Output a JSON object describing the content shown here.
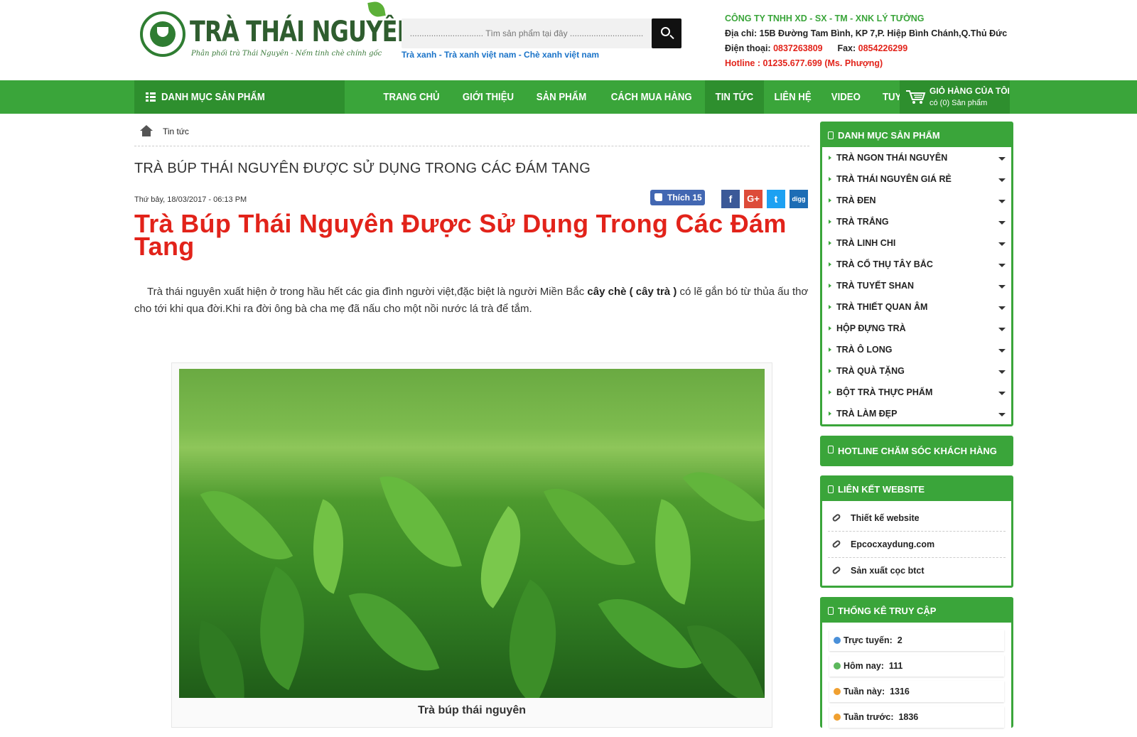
{
  "header": {
    "logo_title": "TRÀ THÁI NGUYÊN",
    "logo_slogan": "Phân phối trà Thái Nguyên - Nếm tinh chè chính gốc",
    "search_placeholder": "............................... Tìm sản phẩm tại đây ...............................",
    "search_tags": "Trà xanh - Trà xanh việt nam - Chè xanh việt nam",
    "company_name": "CÔNG TY TNHH XD - SX - TM - XNK LÝ TƯỞNG",
    "address": "Địa chỉ: 15B Đường Tam Bình, KP 7,P. Hiệp Bình Chánh,Q.Thủ Đức",
    "phone_label": "Điện thoại:",
    "phone": "0837263809",
    "fax_label": "Fax:",
    "fax": "0854226299",
    "hotline": "Hotline : 01235.677.699 (Ms. Phượng)"
  },
  "nav": {
    "category_button": "DANH MỤC SẢN PHẨM",
    "items": [
      "TRANG CHỦ",
      "GIỚI THIỆU",
      "SẢN PHẨM",
      "CÁCH MUA HÀNG",
      "TIN TỨC",
      "LIÊN HỆ",
      "VIDEO",
      "TUYỂN DỤNG"
    ],
    "active": "TIN TỨC",
    "cart_title": "GIỎ HÀNG CỦA TÔI",
    "cart_count": "có (0) Sản phẩm"
  },
  "breadcrumb": "Tin tức",
  "article": {
    "page_title": "TRÀ BÚP THÁI NGUYÊN ĐƯỢC SỬ DỤNG TRONG CÁC ĐÁM TANG",
    "date": "Thứ bảy, 18/03/2017 - 06:13 PM",
    "like_label": "Thích 15",
    "share": [
      "f",
      "G+",
      "t",
      "digg"
    ],
    "headline": "Trà Búp Thái Nguyên Được Sử Dụng Trong Các Đám Tang",
    "intro_a": "Trà thái nguyên xuất hiện ở trong hầu hết các gia đình người việt,đặc biệt là người Miền Bắc ",
    "intro_bold": "cây chè ( cây trà )",
    "intro_b": " có lẽ gắn bó từ thủa ấu thơ cho tới khi qua đời.Khi ra đời ông bà cha mẹ đã nấu cho một nồi nước lá trà để tắm.",
    "image_caption": "Trà búp thái nguyên"
  },
  "sidebar": {
    "categories_title": "DANH MỤC SẢN PHẨM",
    "categories": [
      "TRÀ NGON THÁI NGUYÊN",
      "TRÀ THÁI NGUYÊN GIÁ RẺ",
      "TRÀ ĐEN",
      "TRÀ TRẮNG",
      "TRÀ LINH CHI",
      "TRÀ CỔ THỤ TÂY BẮC",
      "TRÀ TUYẾT SHAN",
      "TRÀ THIẾT QUAN ÂM",
      "HỘP ĐỰNG TRÀ",
      "TRÀ Ô LONG",
      "TRÀ QUÀ TẶNG",
      "BỘT TRÀ THỰC PHẨM",
      "TRÀ LÀM ĐẸP"
    ],
    "hotline_title": "HOTLINE CHĂM SÓC KHÁCH HÀNG",
    "links_title": "LIÊN KẾT WEBSITE",
    "links": [
      "Thiết kế website",
      "Epcocxaydung.com",
      "Sản xuất cọc btct"
    ],
    "stats_title": "THỐNG KÊ TRUY CẬP",
    "stats": [
      {
        "label": "Trực tuyến:",
        "value": "2"
      },
      {
        "label": "Hôm nay:",
        "value": "111"
      },
      {
        "label": "Tuần này:",
        "value": "1316"
      },
      {
        "label": "Tuần trước:",
        "value": "1836"
      }
    ]
  },
  "colors": {
    "brand_green": "#3aa53a",
    "dark_green": "#2e8f2e",
    "headline_red": "#e2231a",
    "link_blue": "#1a73c8"
  }
}
